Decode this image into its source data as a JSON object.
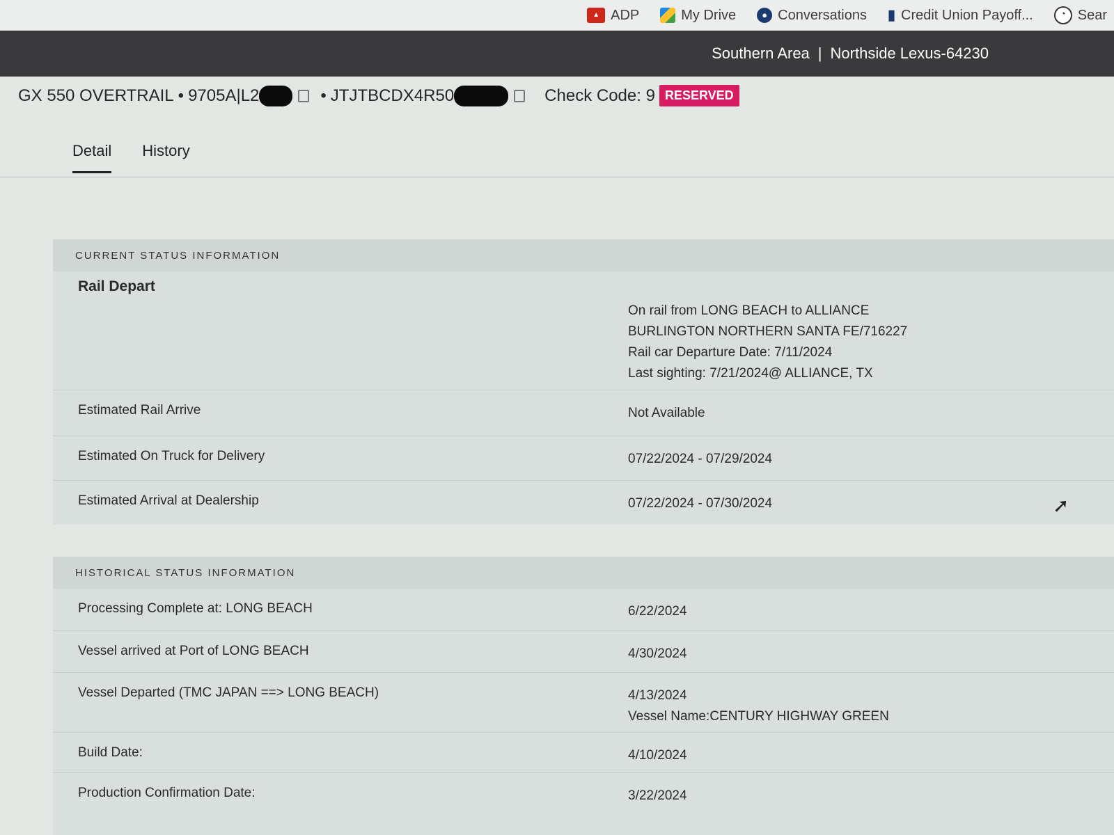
{
  "bookmarks": [
    {
      "label": "ADP",
      "icon": "adp-icon"
    },
    {
      "label": "My Drive",
      "icon": "drive-icon"
    },
    {
      "label": "Conversations",
      "icon": "conversations-icon"
    },
    {
      "label": "Credit Union Payoff...",
      "icon": "fi-icon"
    },
    {
      "label": "Sear",
      "icon": "search-icon"
    }
  ],
  "header": {
    "area": "Southern Area",
    "dealer": "Northside Lexus-64230"
  },
  "vehicle": {
    "model": "GX 550 OVERTRAIL",
    "code_prefix": "9705A|L2",
    "vin_prefix": "JTJTBCDX4R50",
    "check_code": "Check Code: 9",
    "status_badge": "RESERVED"
  },
  "tabs": [
    "Detail",
    "History"
  ],
  "current_status": {
    "heading": "CURRENT STATUS INFORMATION",
    "rows": [
      {
        "label": "Rail Depart",
        "lines": [
          "On rail from LONG BEACH to ALLIANCE",
          "BURLINGTON NORTHERN SANTA FE/716227",
          "Rail car Departure Date: 7/11/2024",
          "Last sighting:    7/21/2024@ ALLIANCE, TX"
        ]
      },
      {
        "label": "Estimated Rail Arrive",
        "lines": [
          "Not Available"
        ]
      },
      {
        "label": "Estimated On Truck for Delivery",
        "lines": [
          "07/22/2024 - 07/29/2024"
        ]
      },
      {
        "label": "Estimated Arrival at Dealership",
        "lines": [
          "07/22/2024 - 07/30/2024"
        ]
      }
    ]
  },
  "historical_status": {
    "heading": "HISTORICAL STATUS INFORMATION",
    "rows": [
      {
        "label": "Processing Complete at: LONG BEACH",
        "lines": [
          "6/22/2024"
        ]
      },
      {
        "label": "Vessel arrived at Port of LONG BEACH",
        "lines": [
          "4/30/2024"
        ]
      },
      {
        "label": "Vessel Departed (TMC JAPAN ==> LONG BEACH)",
        "lines": [
          "4/13/2024",
          "Vessel Name:CENTURY HIGHWAY GREEN"
        ]
      },
      {
        "label": "Build Date:",
        "lines": [
          "4/10/2024"
        ]
      },
      {
        "label": "Production Confirmation Date:",
        "lines": [
          "3/22/2024"
        ]
      }
    ]
  }
}
